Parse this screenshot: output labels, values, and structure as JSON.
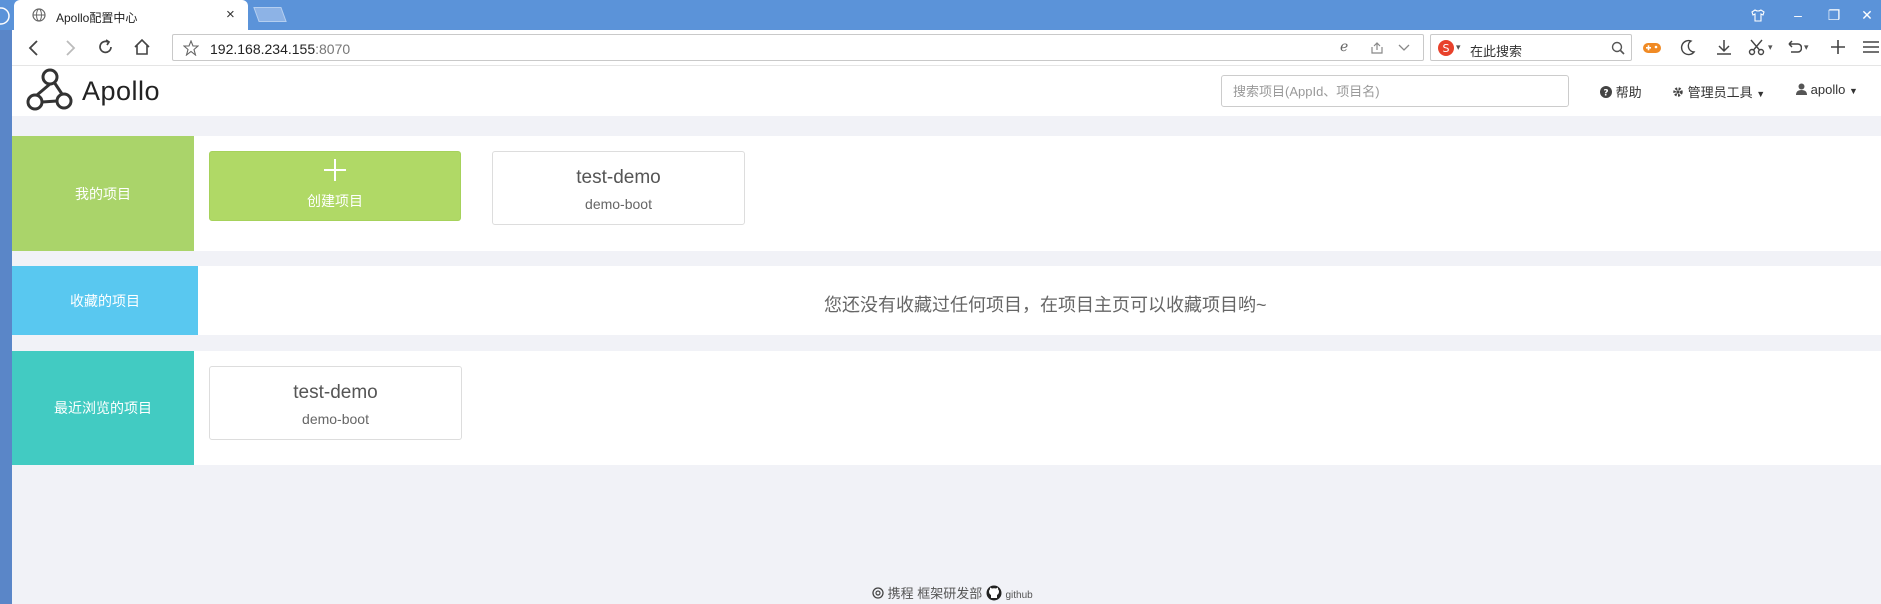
{
  "browser": {
    "tab_title": "Apollo配置中心",
    "tab_close": "×",
    "address": {
      "host": "192.168.234.155",
      "port": ":8070"
    },
    "search_engine_placeholder": "在此搜索",
    "window_buttons": [
      "▾",
      "–",
      "❐",
      "✕"
    ]
  },
  "app": {
    "logo_text": "Apollo",
    "search": {
      "placeholder": "搜索项目(AppId、项目名)"
    },
    "nav": {
      "help": "帮助",
      "admin_tools": "管理员工具",
      "user": "apollo"
    }
  },
  "sections": {
    "my_projects": {
      "label": "我的项目",
      "create_label": "创建项目",
      "projects": [
        {
          "name": "test-demo",
          "sub": "demo-boot"
        }
      ]
    },
    "favorites": {
      "label": "收藏的项目",
      "empty_message": "您还没有收藏过任何项目，在项目主页可以收藏项目哟~"
    },
    "recent": {
      "label": "最近浏览的项目",
      "projects": [
        {
          "name": "test-demo",
          "sub": "demo-boot"
        }
      ]
    }
  },
  "footer": {
    "text": "携程 框架研发部",
    "github": "github"
  },
  "colors": {
    "my_projects": "#aad46a",
    "favorites": "#59c8f0",
    "recent": "#42cbc2",
    "create_card": "#b0d966",
    "browser_tabbar": "#5b93d9"
  },
  "icons": [
    "globe-icon",
    "back-icon",
    "forward-icon",
    "reload-icon",
    "home-icon",
    "star-icon",
    "plus-icon",
    "question-icon",
    "gear-icon",
    "user-icon",
    "caret-down-icon",
    "github-icon",
    "copyright-icon"
  ]
}
